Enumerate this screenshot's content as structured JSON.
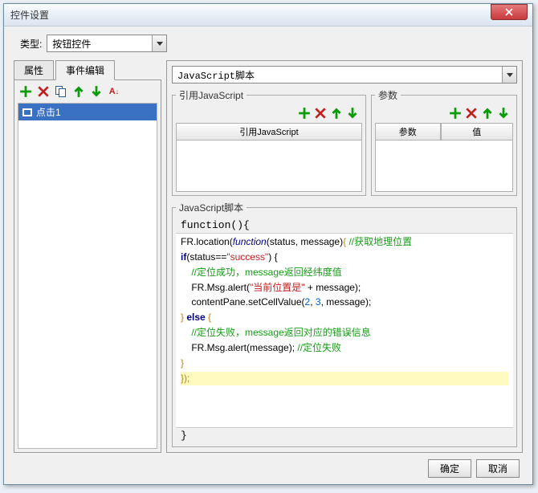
{
  "window": {
    "title": "控件设置"
  },
  "type_row": {
    "label": "类型:",
    "value": "按钮控件"
  },
  "tabs": {
    "properties": "属性",
    "events": "事件编辑"
  },
  "event_list": {
    "items": [
      "点击1"
    ]
  },
  "script_type": {
    "value": "JavaScript脚本"
  },
  "import_panel": {
    "legend": "引用JavaScript",
    "header": "引用JavaScript"
  },
  "param_panel": {
    "legend": "参数",
    "col1": "参数",
    "col2": "值"
  },
  "script_panel": {
    "legend": "JavaScript脚本",
    "fn_open": "function(){",
    "fn_close": "}",
    "code": {
      "l1a": "FR.location(",
      "l1b": "function",
      "l1c": "(status, message)",
      "l1d": "{",
      "l1e": " //获取地理位置",
      "l2a": "if",
      "l2b": "(status==",
      "l2c": "\"success\"",
      "l2d": ") {",
      "l3": "    //定位成功，message返回经纬度值",
      "l4a": "    FR.Msg.alert(",
      "l4b": "\"当前位置是\"",
      "l4c": " + message);",
      "l5a": "    contentPane.setCellValue(",
      "l5b": "2",
      "l5c": ", ",
      "l5d": "3",
      "l5e": ", message);",
      "l6a": "} ",
      "l6b": "else",
      "l6c": " {",
      "l7": "    //定位失败，message返回对应的错误信息",
      "l8a": "    FR.Msg.alert(message); ",
      "l8b": "//定位失败",
      "l9": "}",
      "l10": "});"
    }
  },
  "footer": {
    "ok": "确定",
    "cancel": "取消"
  }
}
